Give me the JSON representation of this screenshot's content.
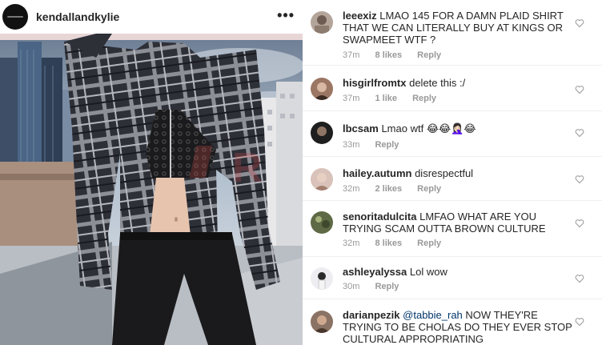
{
  "post": {
    "username": "kendallandkylie",
    "more_icon": "more-dots-icon",
    "watermark": "R"
  },
  "comments": [
    {
      "username": "leeexiz",
      "text": "LMAO 145 FOR A DAMN PLAID SHIRT THAT WE CAN LITERALLY BUY AT KINGS OR SWAPMEET WTF ?",
      "time": "37m",
      "likes": "8 likes",
      "reply": "Reply",
      "avatar_color": "#a89890"
    },
    {
      "username": "hisgirlfromtx",
      "text": "delete this :/",
      "time": "37m",
      "likes": "1 like",
      "reply": "Reply",
      "avatar_color": "#6b4a3a"
    },
    {
      "username": "lbcsam",
      "text": "Lmao wtf",
      "emoji": "😂😂🤦🏻‍♀️😂",
      "time": "33m",
      "likes": "",
      "reply": "Reply",
      "avatar_color": "#2a2a2a"
    },
    {
      "username": "hailey.autumn",
      "text": "disrespectful",
      "time": "32m",
      "likes": "2 likes",
      "reply": "Reply",
      "avatar_color": "#c9a8a0"
    },
    {
      "username": "senoritadulcita",
      "text": "LMFAO WHAT ARE YOU TRYING SCAM OUTTA BROWN CULTURE",
      "time": "32m",
      "likes": "8 likes",
      "reply": "Reply",
      "avatar_color": "#4f5a3c"
    },
    {
      "username": "ashleyalyssa",
      "text": "Lol wow",
      "time": "30m",
      "likes": "",
      "reply": "Reply",
      "avatar_color": "#e6e6ea"
    },
    {
      "username": "darianpezik",
      "mention": "@tabbie_rah",
      "text": "NOW THEY'RE TRYING TO BE CHOLAS DO THEY EVER STOP CULTURAL APPROPRIATING",
      "time": "",
      "likes": "",
      "reply": "",
      "avatar_color": "#7a6355"
    }
  ]
}
